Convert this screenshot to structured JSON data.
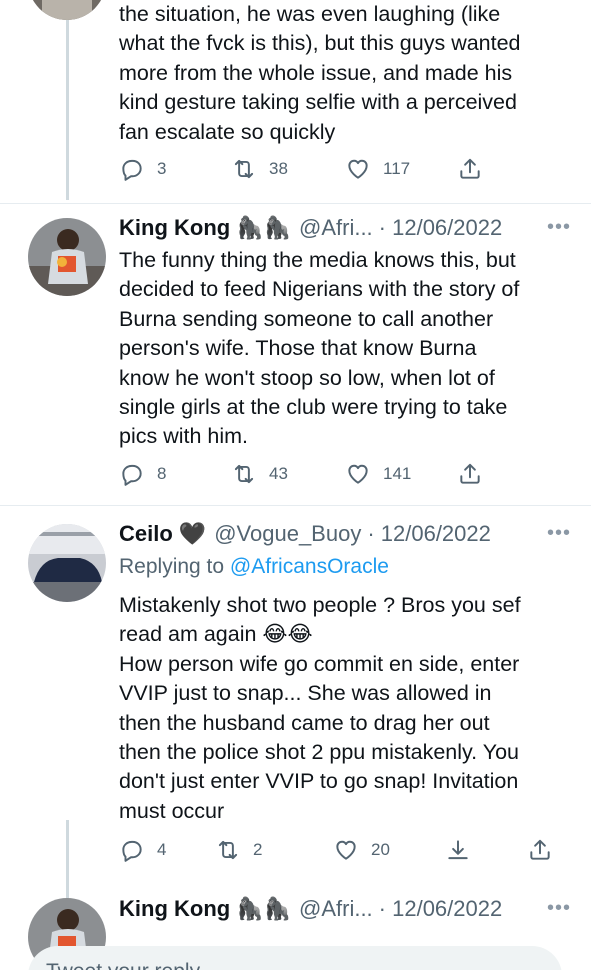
{
  "tweet1": {
    "text_lines": [
      "the situation, he was even laughing (like",
      "what the fvck is this), but this guys wanted",
      "more from the whole issue, and made his",
      "kind gesture taking selfie with a perceived",
      "fan escalate so quickly"
    ],
    "replies": "3",
    "retweets": "38",
    "likes": "117"
  },
  "tweet2": {
    "name": "King Kong",
    "emoji": "🦍🦍",
    "handle": "@Afri...",
    "date": "· 12/06/2022",
    "text_lines": [
      "The funny thing the media knows this, but",
      "decided to feed Nigerians with the story of",
      "Burna sending someone to call another",
      "person's wife. Those that know Burna",
      "know he won't stoop so low, when lot of",
      "single girls at the club were trying to take",
      "pics with him."
    ],
    "replies": "8",
    "retweets": "43",
    "likes": "141"
  },
  "tweet3": {
    "name": "Ceilo",
    "emoji": "🖤",
    "handle": "@Vogue_Buoy",
    "date": "· 12/06/2022",
    "replying_label": "Replying to",
    "replying_handle": "@AfricansOracle",
    "text_lines": [
      "Mistakenly shot two people ? Bros you sef",
      "read am again 😂😂",
      "How person wife go commit en side, enter",
      "VVIP just to snap... She was allowed in",
      "then the husband came to drag her out",
      "then the police shot 2 ppu mistakenly. You",
      "don't just enter VVIP to go snap! Invitation",
      "must occur"
    ],
    "replies": "4",
    "retweets": "2",
    "likes": "20"
  },
  "tweet4": {
    "name": "King Kong",
    "emoji": "🦍🦍",
    "handle": "@Afri...",
    "date": "· 12/06/2022"
  },
  "more_glyph": "•••",
  "compose_placeholder": "Tweet your reply",
  "icons": [
    "reply-icon",
    "retweet-icon",
    "like-icon",
    "share-icon",
    "bookmark-icon",
    "more-icon"
  ],
  "colors": {
    "link": "#1d9bf0",
    "muted": "#536471",
    "divider": "#e6ecf0",
    "thread": "#cfd9de"
  }
}
